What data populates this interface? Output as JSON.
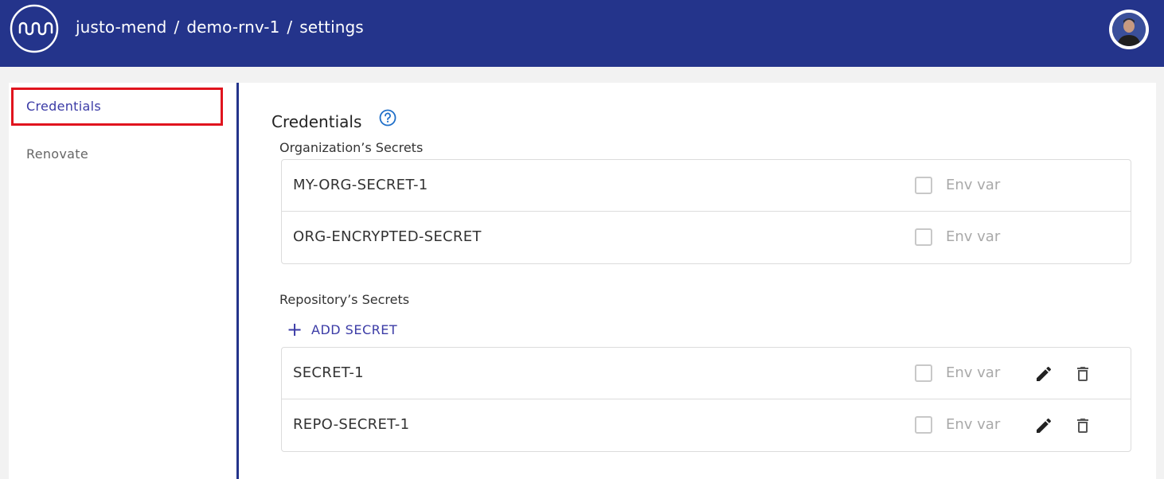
{
  "header": {
    "breadcrumb": [
      "justo-mend",
      "demo-rnv-1",
      "settings"
    ],
    "separator": "/"
  },
  "sidebar": {
    "items": [
      {
        "label": "Credentials",
        "active": true
      },
      {
        "label": "Renovate",
        "active": false
      }
    ]
  },
  "main": {
    "title": "Credentials",
    "org_section_label": "Organization’s Secrets",
    "org_secrets": [
      {
        "name": "MY-ORG-SECRET-1",
        "env_label": "Env var",
        "env_checked": false
      },
      {
        "name": "ORG-ENCRYPTED-SECRET",
        "env_label": "Env var",
        "env_checked": false
      }
    ],
    "repo_section_label": "Repository’s Secrets",
    "add_secret_label": "ADD SECRET",
    "repo_secrets": [
      {
        "name": "SECRET-1",
        "env_label": "Env var",
        "env_checked": false
      },
      {
        "name": "REPO-SECRET-1",
        "env_label": "Env var",
        "env_checked": false
      }
    ]
  },
  "colors": {
    "header_bg": "#24348b",
    "accent": "#3b3ba6",
    "highlight_box": "#e0141e",
    "help_icon": "#1f6fc9"
  },
  "icons": [
    "app-logo-icon",
    "user-avatar",
    "help-circle-icon",
    "plus-icon",
    "pencil-icon",
    "trash-icon"
  ]
}
